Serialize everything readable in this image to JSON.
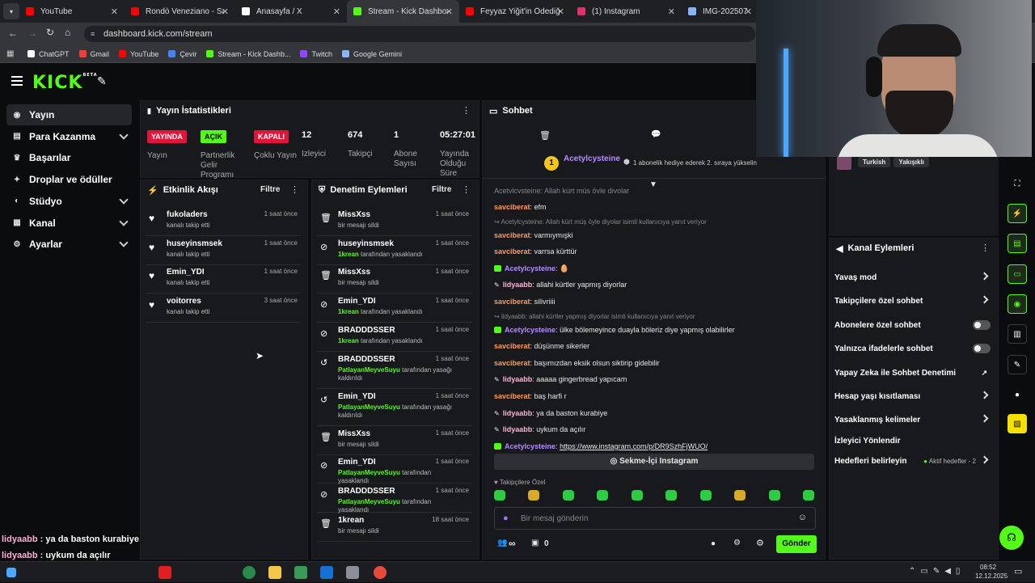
{
  "browser": {
    "tabs": [
      {
        "label": "YouTube",
        "color": "#ff0000",
        "active": false
      },
      {
        "label": "Rondò Veneziano - San M",
        "color": "#ff0000",
        "active": false
      },
      {
        "label": "Anasayfa / X",
        "color": "#ffffff",
        "active": false
      },
      {
        "label": "Stream - Kick Dashboard",
        "color": "#53fc18",
        "active": true
      },
      {
        "label": "Feyyaz Yiğit'in Ödediği Aç",
        "color": "#ff0000",
        "active": false
      },
      {
        "label": "(1) Instagram",
        "color": "#e1306c",
        "active": false
      },
      {
        "label": "IMG-20250704-",
        "color": "#8ab4f8",
        "active": false
      }
    ],
    "url": "dashboard.kick.com/stream",
    "bookmarks": [
      {
        "label": "ChatGPT",
        "color": "#ffffff"
      },
      {
        "label": "Gmail",
        "color": "#ea4335"
      },
      {
        "label": "YouTube",
        "color": "#ff0000"
      },
      {
        "label": "Çevir",
        "color": "#4285f4"
      },
      {
        "label": "Stream - Kick Dashb...",
        "color": "#53fc18"
      },
      {
        "label": "Twitch",
        "color": "#9146ff"
      },
      {
        "label": "Google Gemini",
        "color": "#8ab4f8"
      }
    ]
  },
  "brand": {
    "logo": "KICK",
    "beta": "BETA",
    "accent": "#53fc18"
  },
  "sidebar": {
    "items": [
      {
        "label": "Yayın",
        "icon": "broadcast-icon"
      },
      {
        "label": "Para Kazanma",
        "icon": "money-icon"
      },
      {
        "label": "Başarılar",
        "icon": "trophy-icon"
      },
      {
        "label": "Droplar ve ödüller",
        "icon": "gift-icon"
      },
      {
        "label": "Stüdyo",
        "icon": "palette-icon"
      },
      {
        "label": "Kanal",
        "icon": "channel-icon"
      },
      {
        "label": "Ayarlar",
        "icon": "gear-icon"
      }
    ]
  },
  "stats": {
    "title": "Yayın İstatistikleri",
    "items": [
      {
        "value": "YAYINDA",
        "label": "Yayın",
        "type": "red"
      },
      {
        "value": "AÇIK",
        "label": "Partnerlik Gelir Programı",
        "type": "green"
      },
      {
        "value": "KAPALI",
        "label": "Çoklu Yayın",
        "type": "red"
      },
      {
        "value": "12",
        "label": "İzleyici"
      },
      {
        "value": "674",
        "label": "Takipçi"
      },
      {
        "value": "1",
        "label": "Abone Sayısı"
      },
      {
        "value": "05:27:01",
        "label": "Yayında Olduğu Süre"
      }
    ]
  },
  "activity": {
    "title": "Etkinlik Akışı",
    "filter": "Filtre",
    "rows": [
      {
        "name": "fukoladers",
        "sub": "kanalı takip etti",
        "time": "1 saat önce"
      },
      {
        "name": "huseyinsmsek",
        "sub": "kanalı takip etti",
        "time": "1 saat önce"
      },
      {
        "name": "Emin_YDI",
        "sub": "kanalı takip etti",
        "time": "1 saat önce"
      },
      {
        "name": "voitorres",
        "sub": "kanalı takip etti",
        "time": "3 saat önce"
      }
    ]
  },
  "moderation": {
    "title": "Denetim Eylemleri",
    "filter": "Filtre",
    "rows": [
      {
        "icon": "trash-icon",
        "name": "MissXss",
        "actor": "",
        "sub": "bir mesajı sildi",
        "time": "1 saat önce"
      },
      {
        "icon": "ban-icon",
        "name": "huseyinsmsek",
        "actor": "1krean",
        "sub": "tarafından yasaklandı",
        "time": "1 saat önce"
      },
      {
        "icon": "trash-icon",
        "name": "MissXss",
        "actor": "",
        "sub": "bir mesajı sildi",
        "time": "1 saat önce"
      },
      {
        "icon": "ban-icon",
        "name": "Emin_YDI",
        "actor": "1krean",
        "sub": "tarafından yasaklandı",
        "time": "1 saat önce"
      },
      {
        "icon": "ban-icon",
        "name": "BRADDDSSER",
        "actor": "1krean",
        "sub": "tarafından yasaklandı",
        "time": "1 saat önce"
      },
      {
        "icon": "undo-icon",
        "name": "BRADDDSSER",
        "actor": "PatlayanMeyveSuyu",
        "sub": "tarafından yasağı kaldırıldı",
        "time": "1 saat önce"
      },
      {
        "icon": "undo-icon",
        "name": "Emin_YDI",
        "actor": "PatlayanMeyveSuyu",
        "sub": "tarafından yasağı kaldırıldı",
        "time": "1 saat önce"
      },
      {
        "icon": "trash-icon",
        "name": "MissXss",
        "actor": "",
        "sub": "bir mesajı sildi",
        "time": "1 saat önce"
      },
      {
        "icon": "ban-icon",
        "name": "Emin_YDI",
        "actor": "PatlayanMeyveSuyu",
        "sub": "tarafından yasaklandı",
        "time": "1 saat önce"
      },
      {
        "icon": "ban-icon",
        "name": "BRADDDSSER",
        "actor": "PatlayanMeyveSuyu",
        "sub": "tarafından yasaklandı",
        "time": "1 saat önce"
      },
      {
        "icon": "trash-icon",
        "name": "1krean",
        "actor": "",
        "sub": "bir mesajı sildi",
        "time": "18 saat önce"
      }
    ]
  },
  "chat": {
    "title": "Sohbet",
    "pinned_user": "Acetylcysteine",
    "pinned_count": "1",
    "pinned_text": "1 abonelik hediye ederek 2. sıraya yükselin",
    "top_cut": "Acetylcysteine: Allah kürt müş öyle diyolar",
    "messages": [
      {
        "user": "savciberat",
        "cls": "u1",
        "text": "efm"
      },
      {
        "reply": "Acetylcysteine: Allah kürt müş öyle diyolar isimli kullanıcıya yanıt veriyor"
      },
      {
        "user": "savciberat",
        "cls": "u1",
        "text": "varmıymışki"
      },
      {
        "user": "savciberat",
        "cls": "u1",
        "text": "varrsa kürttür"
      },
      {
        "user": "Acetylcysteine",
        "cls": "u2",
        "text": "🥚",
        "badge": true
      },
      {
        "user": "lidyaabb",
        "cls": "u3",
        "text": "allahi kürtler yapmış diyorlar"
      },
      {
        "user": "savciberat",
        "cls": "u1",
        "text": "silivriiii"
      },
      {
        "reply": "lidyaabb: allahi kürtler yapmış diyorlar isimli kullanıcıya yanıt veriyor"
      },
      {
        "user": "Acetylcysteine",
        "cls": "u2",
        "text": "ülke bölemeyince duayla böleriz diye yapmış olabilirler",
        "badge": true
      },
      {
        "user": "savciberat",
        "cls": "u1",
        "text": "düşünme sikerler"
      },
      {
        "user": "savciberat",
        "cls": "u1",
        "text": "başımızdan eksik olsun siktirip gidebilir"
      },
      {
        "user": "lidyaabb",
        "cls": "u3",
        "text": "aaaaa gingerbread yapıcam"
      },
      {
        "user": "savciberat",
        "cls": "u1",
        "text": "baş harfi r"
      },
      {
        "user": "lidyaabb",
        "cls": "u3",
        "text": "ya da baston kurabiye"
      },
      {
        "user": "lidyaabb",
        "cls": "u3",
        "text": "uykum da açılır"
      },
      {
        "user": "Acetylcysteine",
        "cls": "u2",
        "text": "https://www.instagram.com/p/DR9SzhFjWUO/",
        "badge": true,
        "link": true
      }
    ],
    "instagram_button": "Sekme-İçi Instagram",
    "followers_only": "Takipçilere Özel",
    "placeholder": "Bir mesaj gönderin",
    "infinity": "∞",
    "count": "0",
    "send": "Gönder"
  },
  "channel": {
    "tags": [
      "Turkish",
      "Yakışıklı"
    ],
    "actions_title": "Kanal Eylemleri",
    "actions": [
      {
        "label": "Yavaş mod",
        "kind": "chevron"
      },
      {
        "label": "Takipçilere özel sohbet",
        "kind": "chevron"
      },
      {
        "label": "Abonelere özel sohbet",
        "kind": "toggle"
      },
      {
        "label": "Yalnızca ifadelerle sohbet",
        "kind": "toggle"
      },
      {
        "label": "Yapay Zeka ile Sohbet Denetimi",
        "kind": "external"
      },
      {
        "label": "Hesap yaşı kısıtlaması",
        "kind": "chevron"
      },
      {
        "label": "Yasaklanmış kelimeler",
        "kind": "chevron"
      },
      {
        "label": "İzleyici Yönlendir",
        "kind": "none"
      },
      {
        "label": "Hedefleri belirleyin",
        "kind": "goal",
        "extra": "Aktif hedefler - 2"
      }
    ]
  },
  "overlay": {
    "lines": [
      {
        "user": "lidyaabb",
        "text": " : ya da baston kurabiye"
      },
      {
        "user": "lidyaabb",
        "text": " : uykum da açılır"
      },
      {
        "user": "Acetylcysteine",
        "text": " : https://www.instagram.com/p/DR9SzhFjWUO/"
      }
    ]
  },
  "taskbar": {
    "time": "08:52",
    "date": "12.12.2025"
  }
}
